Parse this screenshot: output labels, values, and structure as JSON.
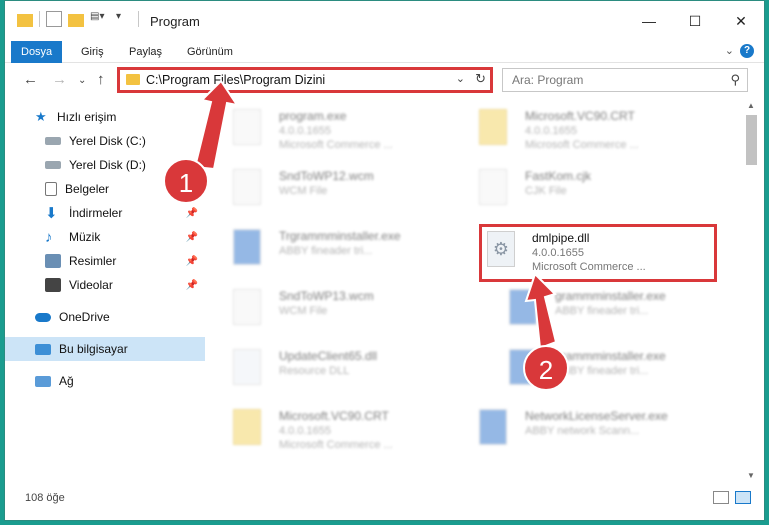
{
  "window": {
    "title": "Program"
  },
  "ribbon": {
    "tabs": [
      "Dosya",
      "Giriş",
      "Paylaş",
      "Görünüm"
    ]
  },
  "address": {
    "path": "C:\\Program Files\\Program Dizini"
  },
  "search": {
    "placeholder": "Ara: Program"
  },
  "sidebar": {
    "items": [
      {
        "label": "Hızlı erişim"
      },
      {
        "label": "Yerel Disk (C:)"
      },
      {
        "label": "Yerel Disk (D:)"
      },
      {
        "label": "Belgeler"
      },
      {
        "label": "İndirmeler"
      },
      {
        "label": "Müzik"
      },
      {
        "label": "Resimler"
      },
      {
        "label": "Videolar"
      },
      {
        "label": "OneDrive"
      },
      {
        "label": "Bu bilgisayar"
      },
      {
        "label": "Ağ"
      }
    ]
  },
  "files": [
    {
      "name": "program.exe",
      "line1": "4.0.0.1655",
      "line2": "Microsoft Commerce ..."
    },
    {
      "name": "Microsoft.VC90.CRT",
      "line1": "4.0.0.1655",
      "line2": "Microsoft Commerce ..."
    },
    {
      "name": "SndToWP12.wcm",
      "line1": "WCM File",
      "line2": ""
    },
    {
      "name": "FastKom.cjk",
      "line1": "CJK File",
      "line2": ""
    },
    {
      "name": "Trgrammminstaller.exe",
      "line1": "ABBY fineader tri...",
      "line2": ""
    },
    {
      "name": "dmlpipe.dll",
      "line1": "4.0.0.1655",
      "line2": "Microsoft Commerce ..."
    },
    {
      "name": "SndToWP13.wcm",
      "line1": "WCM File",
      "line2": ""
    },
    {
      "name": "grammminstaller.exe",
      "line1": "ABBY fineader tri...",
      "line2": ""
    },
    {
      "name": "UpdateClient65.dll",
      "line1": "Resource DLL",
      "line2": ""
    },
    {
      "name": "grammminstaller.exe",
      "line1": "ABBY fineader tri...",
      "line2": ""
    },
    {
      "name": "Microsoft.VC90.CRT",
      "line1": "4.0.0.1655",
      "line2": "Microsoft Commerce ..."
    },
    {
      "name": "NetworkLicenseServer.exe",
      "line1": "ABBY network Scann...",
      "line2": ""
    }
  ],
  "status": {
    "count": "108 öğe"
  },
  "annotations": {
    "badge1": "1",
    "badge2": "2"
  },
  "colors": {
    "accent": "#1979ca",
    "highlight": "#d9383a"
  }
}
